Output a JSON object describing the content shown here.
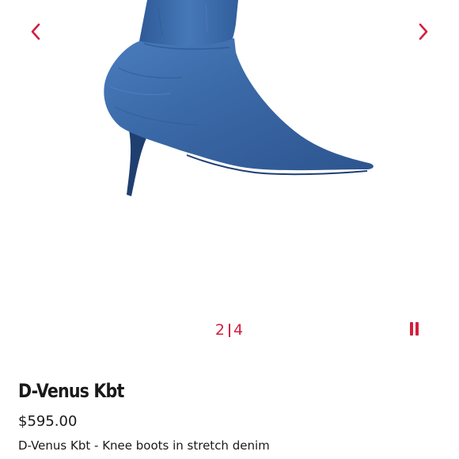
{
  "gallery": {
    "image_alt": "D-Venus Kbt",
    "current_page": "2",
    "total_pages": "4",
    "prev_icon": "chevron-left-icon",
    "next_icon": "chevron-right-icon",
    "pause_icon": "pause-icon",
    "accent_color": "#d41f3f"
  },
  "product": {
    "name": "D-Venus Kbt",
    "price": "$595.00",
    "description": "D-Venus Kbt - Knee boots in stretch denim",
    "denim_color": "#3b6aa8"
  }
}
